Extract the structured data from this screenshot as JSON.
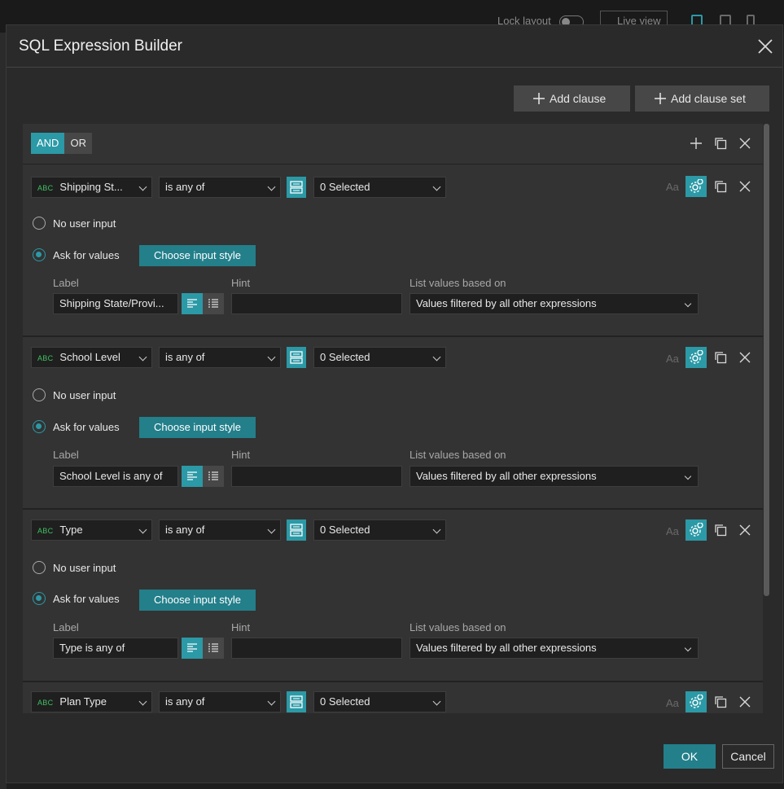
{
  "background": {
    "lock_layout": "Lock layout",
    "live_view": "Live view"
  },
  "dialog": {
    "title": "SQL Expression Builder",
    "add_clause": "Add clause",
    "add_clause_set": "Add clause set",
    "logic": {
      "and": "AND",
      "or": "OR",
      "selected": "AND"
    },
    "ok": "OK",
    "cancel": "Cancel"
  },
  "labels": {
    "no_user_input": "No user input",
    "ask_for_values": "Ask for values",
    "choose_input_style": "Choose input style",
    "label": "Label",
    "hint": "Hint",
    "list_values_based_on": "List values based on",
    "aa": "Aa",
    "abc": "ABC"
  },
  "clauses": [
    {
      "field": "Shipping St...",
      "operator": "is any of",
      "value": "0 Selected",
      "input_mode": "Ask for values",
      "label_value": "Shipping State/Provi...",
      "hint_value": "",
      "list_values": "Values filtered by all other expressions"
    },
    {
      "field": "School Level",
      "operator": "is any of",
      "value": "0 Selected",
      "input_mode": "Ask for values",
      "label_value": "School Level is any of",
      "hint_value": "",
      "list_values": "Values filtered by all other expressions"
    },
    {
      "field": "Type",
      "operator": "is any of",
      "value": "0 Selected",
      "input_mode": "Ask for values",
      "label_value": "Type is any of",
      "hint_value": "",
      "list_values": "Values filtered by all other expressions"
    },
    {
      "field": "Plan Type",
      "operator": "is any of",
      "value": "0 Selected"
    }
  ]
}
